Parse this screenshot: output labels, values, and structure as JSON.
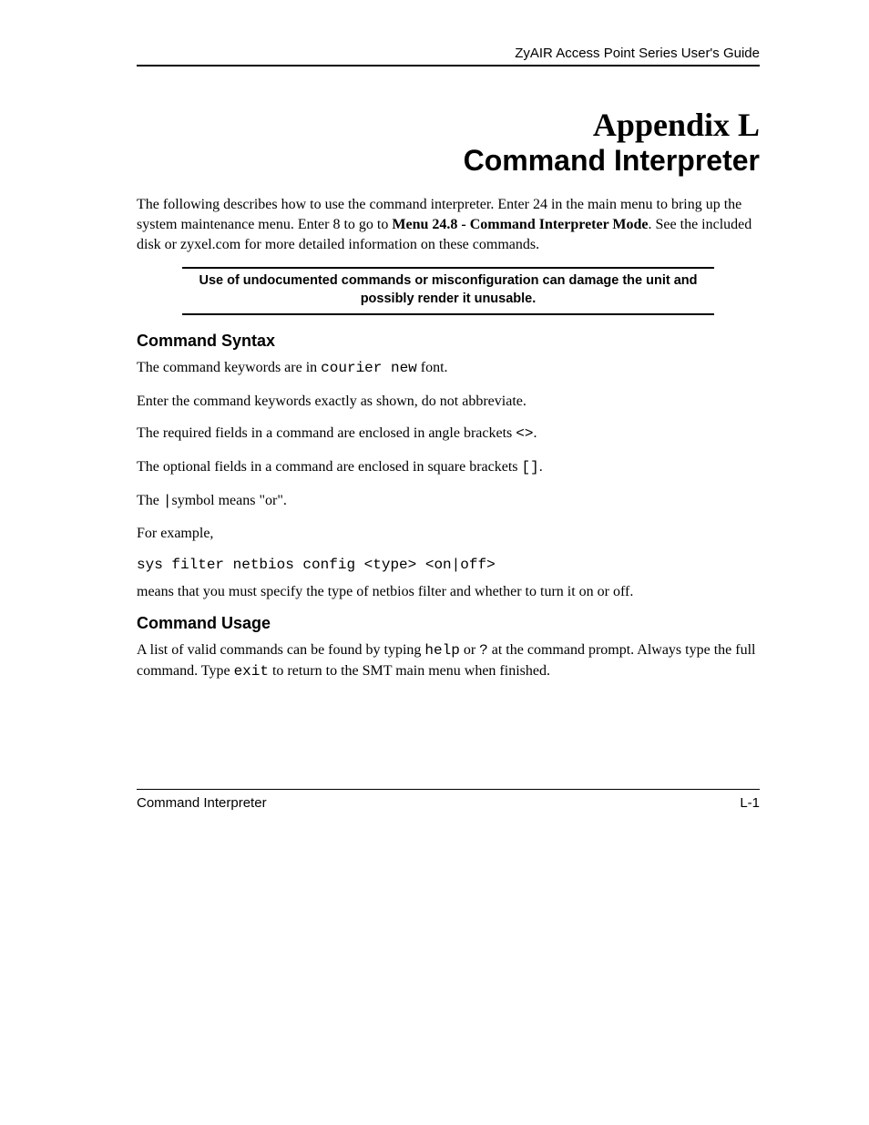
{
  "header": {
    "guide_title": "ZyAIR Access Point Series User's Guide"
  },
  "title": {
    "appendix": "Appendix L",
    "name": "Command Interpreter"
  },
  "intro": {
    "pre": "The following describes how to use the command interpreter. Enter 24 in the main menu to bring up the system maintenance menu. Enter 8 to go to ",
    "bold": "Menu 24.8 - Command Interpreter Mode",
    "post": ". See the included disk or zyxel.com for more detailed information on these commands."
  },
  "warning": "Use of undocumented commands or misconfiguration can damage the unit and possibly render it unusable.",
  "syntax": {
    "heading": "Command Syntax",
    "p1_pre": "The command keywords are in ",
    "p1_code": "courier new",
    "p1_post": " font.",
    "p2": "Enter the command keywords exactly as shown, do not abbreviate.",
    "p3_pre": "The required fields in a command are enclosed in angle brackets ",
    "p3_code": "<>",
    "p3_post": ".",
    "p4_pre": "The optional fields in a command are enclosed in square brackets ",
    "p4_code": "[]",
    "p4_post": ".",
    "p5_pre": "The ",
    "p5_code": "|",
    "p5_post": "symbol means \"or\".",
    "p6": "For example,",
    "code": "sys filter netbios config <type> <on|off>",
    "p7": "means that you must specify the type of netbios filter and whether to turn it on or off."
  },
  "usage": {
    "heading": "Command Usage",
    "p1_a": "A list of valid commands can be found by typing ",
    "p1_code1": "help",
    "p1_b": " or ",
    "p1_code2": "?",
    "p1_c": " at the command prompt. Always type the full command. Type ",
    "p1_code3": "exit",
    "p1_d": " to return to the SMT main menu when finished."
  },
  "footer": {
    "left": "Command Interpreter",
    "right": "L-1"
  }
}
